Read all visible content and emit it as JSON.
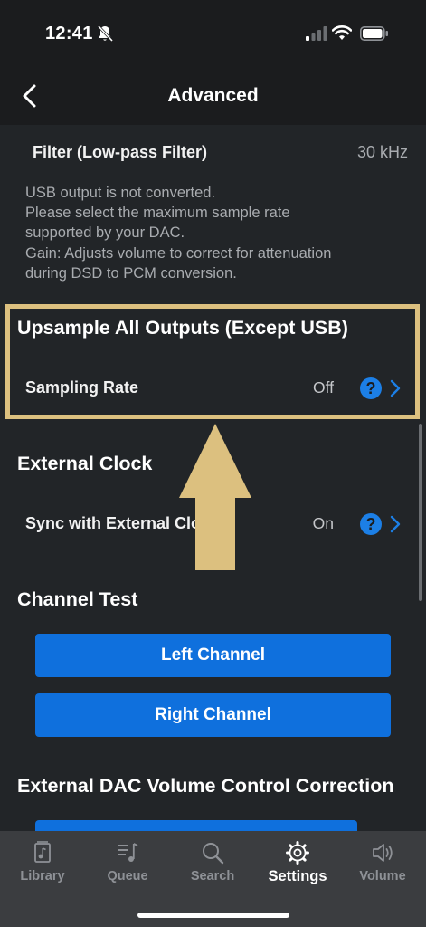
{
  "status_bar": {
    "time": "12:41"
  },
  "nav": {
    "title": "Advanced"
  },
  "filter": {
    "label": "Filter (Low-pass Filter)",
    "value": "30 kHz"
  },
  "note": {
    "lines": [
      "USB output is not converted.",
      "Please select the maximum sample rate",
      "supported by your DAC.",
      "Gain: Adjusts volume to correct for attenuation",
      "during DSD to PCM conversion."
    ]
  },
  "upsample": {
    "title": "Upsample All Outputs (Except USB)",
    "row_label": "Sampling Rate",
    "row_value": "Off",
    "help": "?"
  },
  "external_clock": {
    "title": "External Clock",
    "row_label": "Sync with External Clock",
    "row_value": "On",
    "help": "?"
  },
  "channel_test": {
    "title": "Channel Test",
    "left_button": "Left Channel",
    "right_button": "Right Channel"
  },
  "dac_volume": {
    "title": "External DAC Volume Control Correction"
  },
  "tabs": [
    {
      "label": "Library",
      "icon": "library-icon",
      "active": false
    },
    {
      "label": "Queue",
      "icon": "queue-icon",
      "active": false
    },
    {
      "label": "Search",
      "icon": "search-icon",
      "active": false
    },
    {
      "label": "Settings",
      "icon": "gear-icon",
      "active": true
    },
    {
      "label": "Volume",
      "icon": "volume-icon",
      "active": false
    }
  ],
  "colors": {
    "accent_blue": "#0f70dd",
    "highlight_gold": "#dcc07f",
    "background": "#222528",
    "tab_bar": "#3b3d40"
  }
}
